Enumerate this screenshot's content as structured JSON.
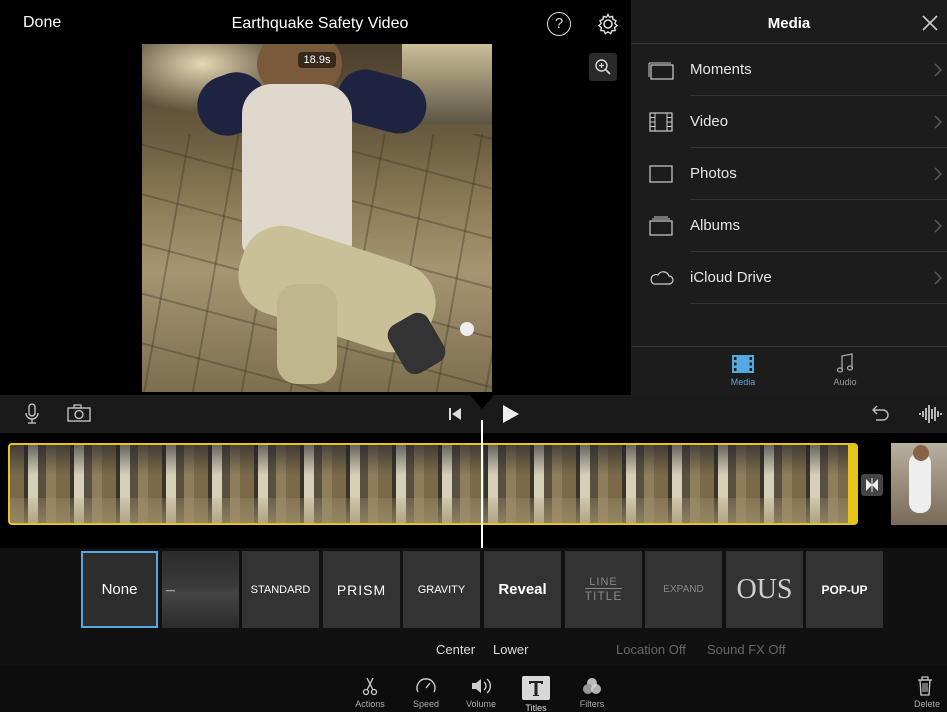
{
  "header": {
    "done_label": "Done",
    "project_title": "Earthquake Safety Video",
    "help_symbol": "?"
  },
  "viewer": {
    "duration_label": "18.9s"
  },
  "media_panel": {
    "title": "Media",
    "items": [
      {
        "label": "Moments",
        "icon": "moments-icon"
      },
      {
        "label": "Video",
        "icon": "film-icon"
      },
      {
        "label": "Photos",
        "icon": "photo-icon"
      },
      {
        "label": "Albums",
        "icon": "albums-icon"
      },
      {
        "label": "iCloud Drive",
        "icon": "cloud-icon"
      }
    ],
    "tabs": [
      {
        "label": "Media",
        "active": true
      },
      {
        "label": "Audio",
        "active": false
      }
    ]
  },
  "title_styles": [
    {
      "label": "None",
      "selected": true
    },
    {
      "label": "—",
      "selected": false
    },
    {
      "label": "STANDARD",
      "selected": false
    },
    {
      "label": "PRISM",
      "selected": false
    },
    {
      "label": "GRAVITY",
      "selected": false
    },
    {
      "label": "Reveal",
      "selected": false
    },
    {
      "label_top": "LINE",
      "label_bottom": "TITLE",
      "selected": false
    },
    {
      "label": "EXPAND",
      "selected": false
    },
    {
      "label": "OUS",
      "selected": false
    },
    {
      "label": "POP-UP",
      "selected": false
    }
  ],
  "options": {
    "center": "Center",
    "lower": "Lower",
    "location": "Location Off",
    "sound_fx": "Sound FX Off"
  },
  "bottom_tools": [
    {
      "label": "Actions",
      "icon": "scissors-icon"
    },
    {
      "label": "Speed",
      "icon": "speedometer-icon"
    },
    {
      "label": "Volume",
      "icon": "speaker-icon"
    },
    {
      "label": "Titles",
      "icon": "titles-icon"
    },
    {
      "label": "Filters",
      "icon": "filters-icon"
    }
  ],
  "delete_label": "Delete",
  "colors": {
    "accent_blue": "#56a8e0",
    "clip_border": "#e8c51c"
  }
}
